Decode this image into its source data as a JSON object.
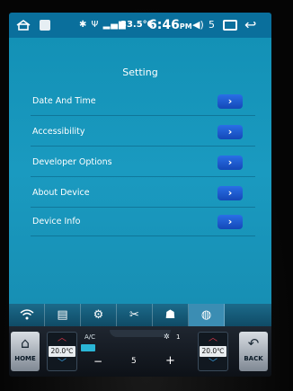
{
  "status_bar": {
    "temperature": "33.5℃",
    "time": "6:46",
    "ampm": "PM",
    "volume_level": "5",
    "icons": [
      "home-icon",
      "app-thumbnail-icon",
      "bluetooth-icon",
      "usb-icon",
      "signal-4g-icon",
      "volume-icon",
      "recents-icon",
      "back-icon"
    ]
  },
  "page": {
    "title": "Setting"
  },
  "menu": [
    {
      "label": "Date And Time"
    },
    {
      "label": "Accessibility"
    },
    {
      "label": "Developer Options"
    },
    {
      "label": "About Device"
    },
    {
      "label": "Device Info"
    }
  ],
  "tabs": [
    {
      "icon": "wifi-icon",
      "active": false
    },
    {
      "icon": "device-info-icon",
      "active": false
    },
    {
      "icon": "gear-icon",
      "active": false
    },
    {
      "icon": "tools-icon",
      "active": false
    },
    {
      "icon": "user-settings-icon",
      "active": false
    },
    {
      "icon": "globe-icon",
      "active": true
    }
  ],
  "climate": {
    "home_label": "HOME",
    "back_label": "BACK",
    "left_temp": "20.0℃",
    "right_temp": "20.0℃",
    "ac_label": "A/C",
    "fan_level": "1",
    "fan_value": "5",
    "minus": "−",
    "plus": "+"
  },
  "colors": {
    "accent": "#1a9ac0",
    "status_bar": "#0a6f9c",
    "button_blue": "#1f5fd6"
  }
}
